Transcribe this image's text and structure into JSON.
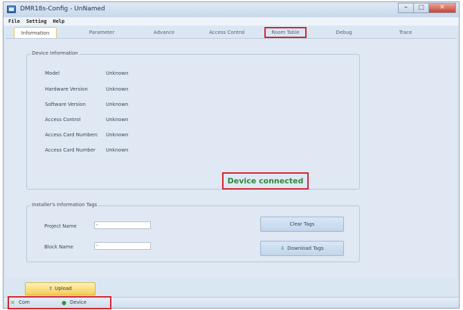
{
  "window": {
    "title": "DMR18s-Config - UnNamed"
  },
  "menu": {
    "items": [
      "File",
      "Setting",
      "Help"
    ]
  },
  "tabs": [
    {
      "label": "Information",
      "active": true
    },
    {
      "label": "Parameter"
    },
    {
      "label": "Advance"
    },
    {
      "label": "Access Control"
    },
    {
      "label": "Room Table",
      "highlighted": true
    },
    {
      "label": "Debug"
    },
    {
      "label": "Trace"
    }
  ],
  "device_info": {
    "group_title": "Device Information",
    "rows": [
      {
        "label": "Model",
        "value": "Unknown"
      },
      {
        "label": "Hardware Version",
        "value": "Unknown"
      },
      {
        "label": "Software Version",
        "value": "Unknown"
      },
      {
        "label": "Access Control",
        "value": "Unknown"
      },
      {
        "label": "Access Card Numberc",
        "value": "Unknown"
      },
      {
        "label": "Access Card Number",
        "value": "Unknown"
      }
    ],
    "status": "Device connected",
    "status_color": "#2a8c3a"
  },
  "installer_tags": {
    "group_title": "Installer's Information Tags",
    "project_name": {
      "label": "Project Name",
      "value": "-"
    },
    "block_name": {
      "label": "Block Name",
      "value": "-"
    },
    "clear_button": "Clear Tags",
    "download_button": "Download Tags"
  },
  "upload_button": "Upload",
  "statusbar": {
    "com_label": "Com",
    "device_label": "Device"
  },
  "colors": {
    "highlight": "#d2232a",
    "connected": "#2a8c3a",
    "upload": "#f3cd55"
  }
}
